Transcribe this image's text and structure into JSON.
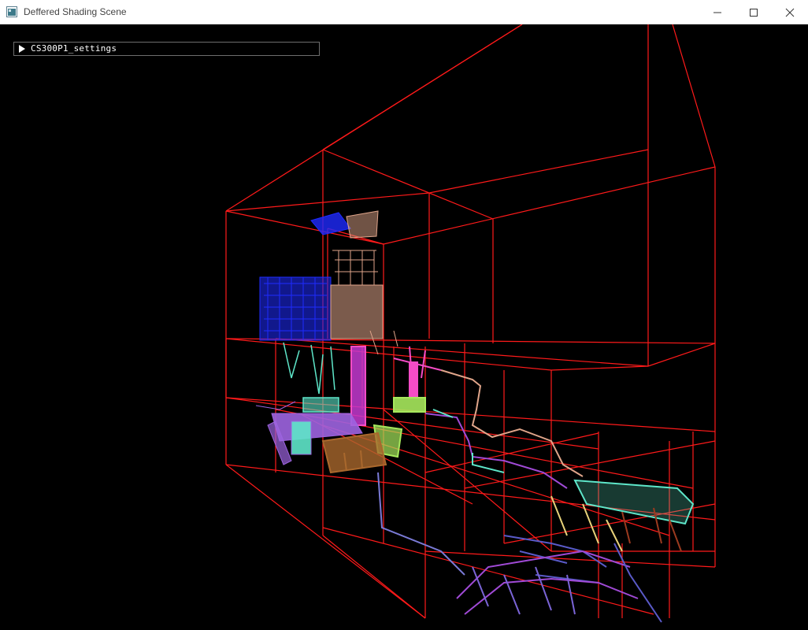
{
  "window": {
    "title": "Deffered Shading Scene",
    "minimize_icon": "minimize-icon",
    "maximize_icon": "maximize-icon",
    "close_icon": "close-icon"
  },
  "settings_panel": {
    "label": "CS300P1_settings",
    "toggle_icon": "triangle-right-icon"
  },
  "scene": {
    "wireframe_color": "#ff1a1a",
    "object_colors": [
      "#1f2bff",
      "#e0a58a",
      "#c43ad1",
      "#9d64e0",
      "#5ee6c9",
      "#a6e85c",
      "#a9682d",
      "#e8d27a",
      "#7a64d6",
      "#a04ad6",
      "#b5e67a",
      "#5a5ac8",
      "#f54cc6"
    ]
  }
}
